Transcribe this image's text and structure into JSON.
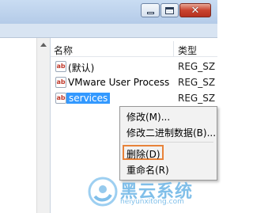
{
  "window": {
    "minimize_icon": "minimize-icon",
    "maximize_icon": "maximize-icon",
    "close_label": "✕"
  },
  "list": {
    "columns": {
      "name": "名称",
      "type": "类型"
    },
    "rows": [
      {
        "icon": "ab",
        "name": "(默认)",
        "type": "REG_SZ"
      },
      {
        "icon": "ab",
        "name": "VMware User Process",
        "type": "REG_SZ"
      },
      {
        "icon": "ab",
        "name": "services",
        "type": "REG_SZ"
      }
    ]
  },
  "context_menu": {
    "items": [
      {
        "label": "修改(M)..."
      },
      {
        "label": "修改二进制数据(B)..."
      },
      {
        "label": "删除(D)"
      },
      {
        "label": "重命名(R)"
      }
    ]
  },
  "watermark": {
    "title": "黑云系统",
    "url": "heiyunxitong.com"
  },
  "colors": {
    "selection": "#3399ff",
    "highlight_box": "#e8833a",
    "watermark": "#6ab4e6"
  }
}
